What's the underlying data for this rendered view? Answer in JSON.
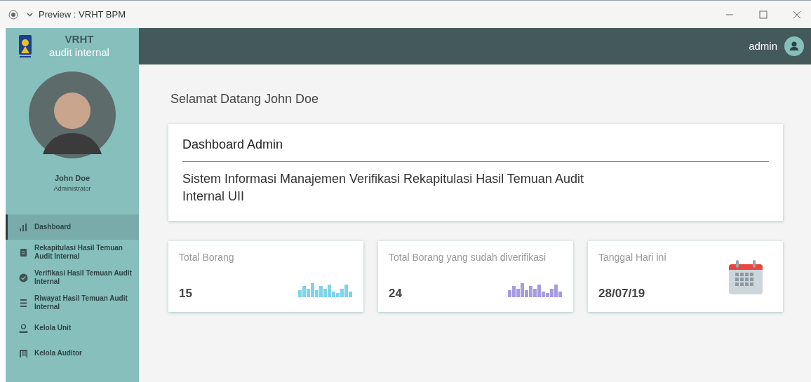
{
  "window": {
    "title": "Preview : VRHT BPM"
  },
  "brand": {
    "title": "VRHT",
    "subtitle": "audit internal"
  },
  "header": {
    "user": "admin"
  },
  "profile": {
    "name": "John Doe",
    "role": "Administrator"
  },
  "sidebar": {
    "items": [
      {
        "label": "Dashboard",
        "selected": true
      },
      {
        "label": "Rekapitulasi Hasil Temuan Audit Internal",
        "selected": false
      },
      {
        "label": "Verifikasi Hasil Temuan Audit Internal",
        "selected": false
      },
      {
        "label": "Riwayat Hasil Temuan Audit Internal",
        "selected": false
      },
      {
        "label": "Kelola Unit",
        "selected": false
      },
      {
        "label": "Kelola Auditor",
        "selected": false
      }
    ]
  },
  "welcome": "Selamat Datang John Doe",
  "dashboard_card": {
    "title": "Dashboard Admin",
    "description": "Sistem Informasi Manajemen Verifikasi Rekapitulasi Hasil Temuan Audit Internal UII"
  },
  "stats": [
    {
      "kind": "bars",
      "label": "Total Borang",
      "value": "15",
      "color": "#7fd3ea"
    },
    {
      "kind": "bars",
      "label": "Total Borang yang sudah diverifikasi",
      "value": "24",
      "color": "#a79be0"
    },
    {
      "kind": "calendar",
      "label": "Tanggal Hari ini",
      "value": "28/07/19"
    }
  ]
}
